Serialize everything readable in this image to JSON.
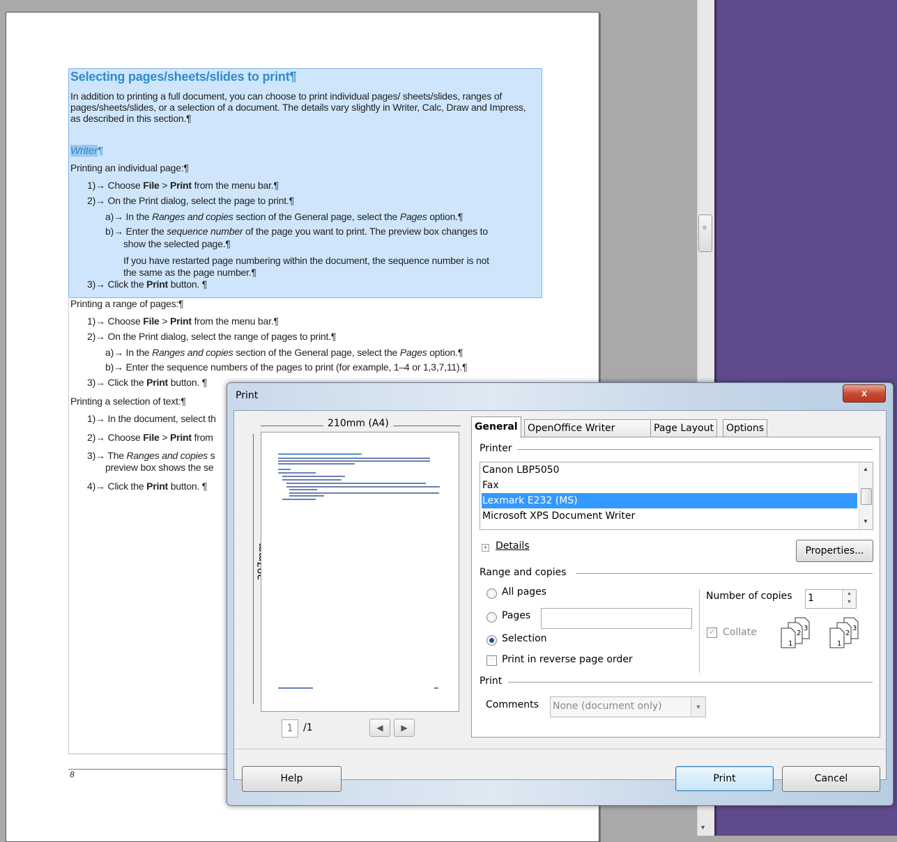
{
  "document": {
    "heading": "Selecting pages/sheets/slides to print¶",
    "intro": "In addition to printing a full document, you can choose to print individual pages/ sheets/slides, ranges of pages/sheets/slides, or a selection of a document. The details vary slightly in Writer, Calc, Draw and Impress, as described in this section.¶",
    "subheading": "Writer",
    "subheading_mark": "¶",
    "individual_title": "Printing an individual page:¶",
    "individual": [
      {
        "pre": "1)→ Choose ",
        "b1": "File",
        "mid": " > ",
        "b2": "Print",
        "post": " from the menu bar.¶"
      },
      {
        "text": "2)→ On the Print dialog, select the page to print.¶"
      },
      {
        "pre": "a)→ In the ",
        "i1": "Ranges and copies",
        "mid": " section of the General page, select the ",
        "i2": "Pages",
        "post": " option.¶"
      },
      {
        "pre": "b)→ Enter the ",
        "i1": "sequence number",
        "post": " of the page you want to print. The preview box changes to"
      },
      {
        "text": "show the selected page.¶"
      },
      {
        "text": "If you have restarted page numbering within the document, the sequence number is not"
      },
      {
        "text": "the same as the page number.¶"
      },
      {
        "pre": "3)→ Click the ",
        "b1": "Print",
        "post": " button. ¶"
      }
    ],
    "range_title": "Printing a range of pages:¶",
    "range": [
      {
        "pre": "1)→ Choose ",
        "b1": "File",
        "mid": " > ",
        "b2": "Print",
        "post": " from the menu bar.¶"
      },
      {
        "text": "2)→ On the Print dialog, select the range of pages to print.¶"
      },
      {
        "pre": "a)→ In the ",
        "i1": "Ranges and copies",
        "mid": " section of the General page, select the ",
        "i2": "Pages",
        "post": " option.¶"
      },
      {
        "text": "b)→ Enter the sequence numbers of the pages to print (for example, 1–4 or 1,3,7,11).¶"
      },
      {
        "pre": "3)→ Click the ",
        "b1": "Print",
        "post": " button. ¶"
      }
    ],
    "selection_title": "Printing a selection of text:¶",
    "selection": [
      {
        "text": "1)→ In the document, select th"
      },
      {
        "pre": "2)→ Choose ",
        "b1": "File",
        "mid": " > ",
        "b2": "Print",
        "post": " from"
      },
      {
        "pre": "3)→ The ",
        "i1": "Ranges and copies",
        "post": " s"
      },
      {
        "text": "preview box shows the se"
      },
      {
        "pre": "4)→ Click the ",
        "b1": "Print",
        "post": " button. ¶"
      }
    ],
    "footer_page": "8"
  },
  "dialog": {
    "title": "Print",
    "close_label": "x",
    "preview": {
      "width_label": "210mm (A4)",
      "height_label": "297mm",
      "page_current": "1",
      "page_total": "/1"
    },
    "tabs": [
      "General",
      "OpenOffice Writer",
      "Page Layout",
      "Options"
    ],
    "printer_section": "Printer",
    "printers": [
      "Canon LBP5050",
      "Fax",
      "Lexmark E232 (MS)",
      "Microsoft XPS Document Writer"
    ],
    "selected_printer": "Lexmark E232 (MS)",
    "details_label": "Details",
    "properties_label": "Properties...",
    "range_section": "Range and copies",
    "all_pages_label": "All pages",
    "pages_label": "Pages",
    "selection_label": "Selection",
    "reverse_label": "Print in reverse page order",
    "copies_label": "Number of copies",
    "copies_value": "1",
    "collate_label": "Collate",
    "print_section": "Print",
    "comments_label": "Comments",
    "comments_value": "None (document only)",
    "help_label": "Help",
    "print_label": "Print",
    "cancel_label": "Cancel"
  },
  "colors": {
    "heading_blue": "#2d8bd0",
    "selection_bg": "#cfe5fb",
    "desktop_purple": "#5f4b8b",
    "list_selection": "#3399ff"
  }
}
